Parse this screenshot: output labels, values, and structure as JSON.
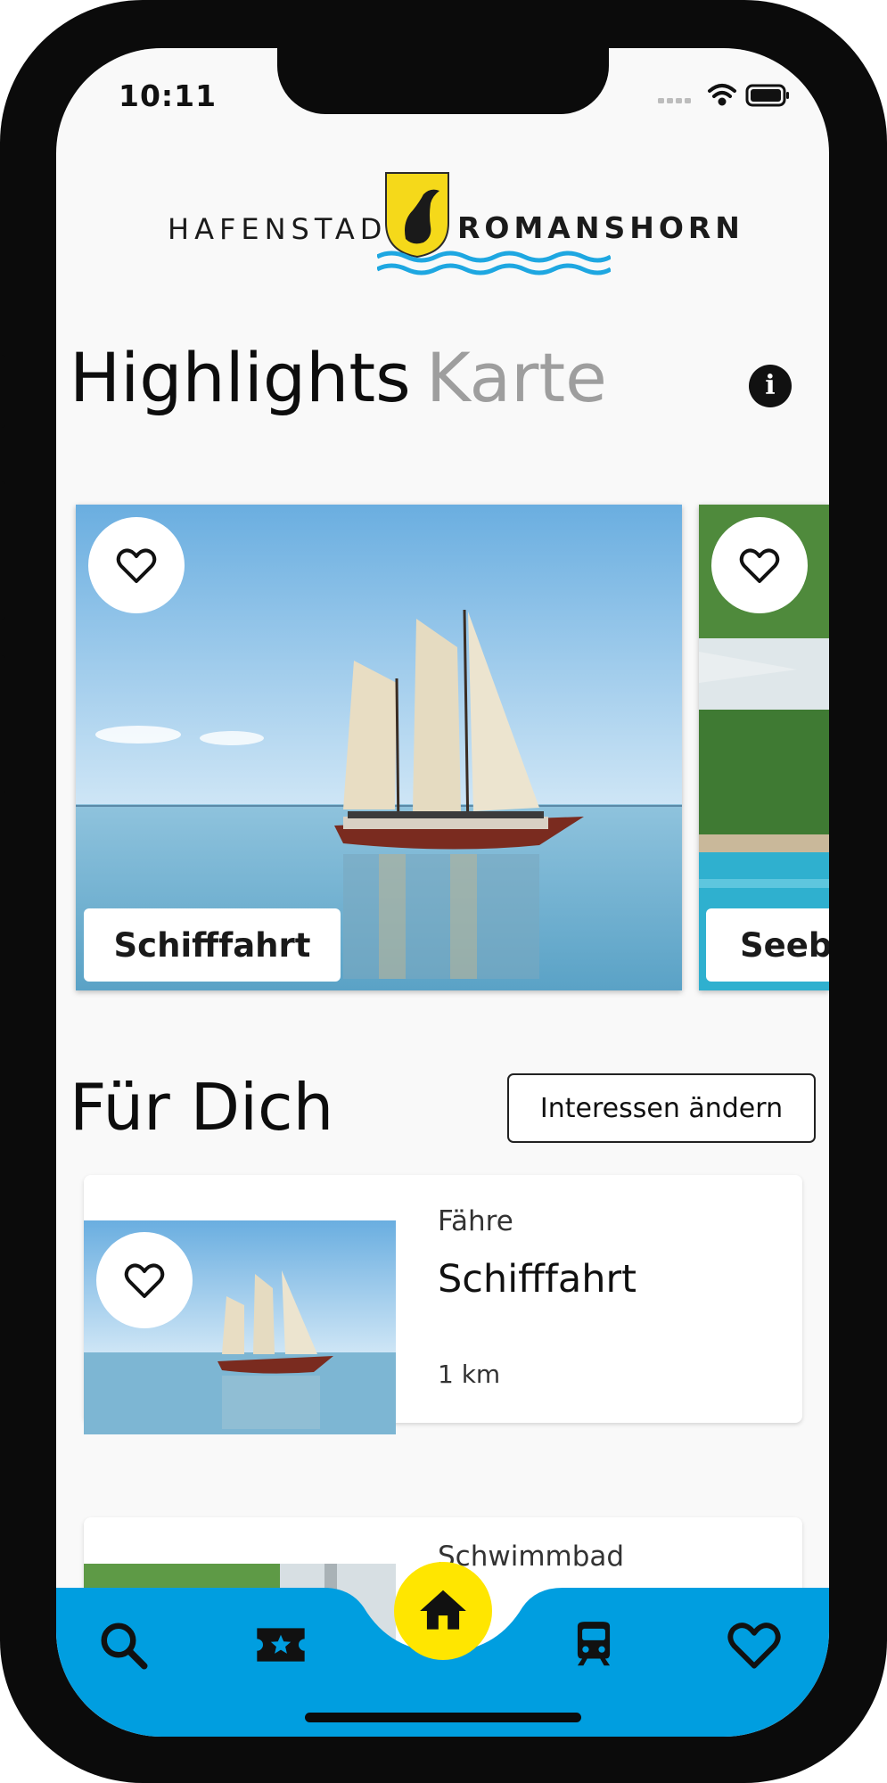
{
  "status_bar": {
    "time": "10:11"
  },
  "header": {
    "logo_left": "HAFENSTADT",
    "logo_right": "ROMANSHORN"
  },
  "tabs": [
    {
      "label": "Highlights",
      "active": true
    },
    {
      "label": "Karte",
      "active": false
    }
  ],
  "highlights": [
    {
      "label": "Schifffahrt",
      "image": "sailing-ship-photo",
      "favorite": false
    },
    {
      "label": "Seeb",
      "image": "pool-garden-photo",
      "favorite": false
    }
  ],
  "for_you": {
    "title": "Für Dich",
    "change_interests_label": "Interessen ändern",
    "items": [
      {
        "category": "Fähre",
        "title": "Schifffahrt",
        "distance": "1 km",
        "image": "sailing-ship-photo"
      },
      {
        "category": "Schwimmbad",
        "title": "",
        "distance": "",
        "image": "pool-garden-photo"
      }
    ]
  },
  "bottom_nav": {
    "items": [
      {
        "icon": "search-icon"
      },
      {
        "icon": "ticket-star-icon"
      },
      {
        "icon": "home-icon",
        "active": true
      },
      {
        "icon": "train-icon"
      },
      {
        "icon": "heart-icon"
      }
    ]
  },
  "colors": {
    "nav_blue": "#009ee0",
    "home_yellow": "#ffe600",
    "crest_yellow": "#f5d91a",
    "wave_blue": "#1ea7e1",
    "inactive_tab": "#9e9e9e"
  }
}
